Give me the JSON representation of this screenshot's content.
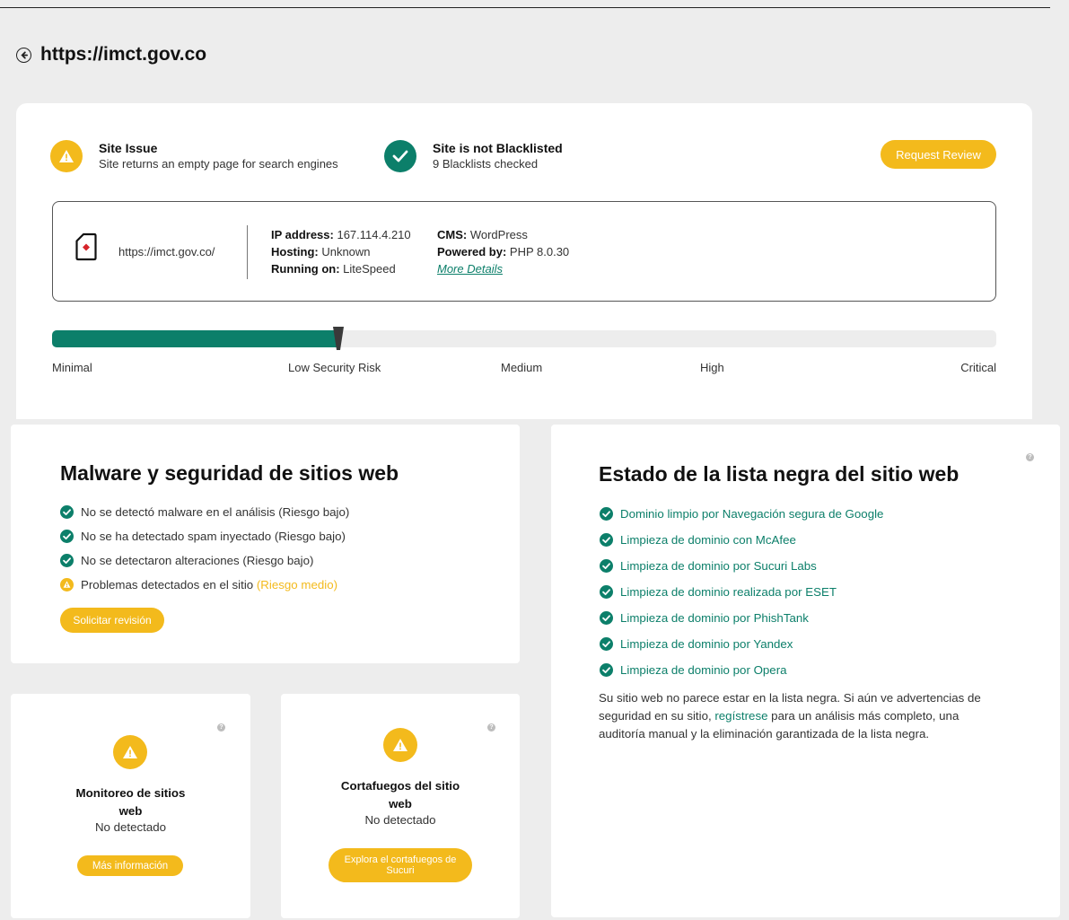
{
  "header": {
    "title": "https://imct.gov.co"
  },
  "summary": {
    "issue_title": "Site Issue",
    "issue_sub": "Site returns an empty page for search engines",
    "blacklist_title": "Site is not Blacklisted",
    "blacklist_sub": "9 Blacklists checked",
    "request_review": "Request Review"
  },
  "site_info": {
    "url": "https://imct.gov.co/",
    "ip_label": "IP address:",
    "ip_value": " 167.114.4.210",
    "hosting_label": "Hosting:",
    "hosting_value": " Unknown",
    "running_label": "Running on:",
    "running_value": " LiteSpeed",
    "cms_label": "CMS:",
    "cms_value": " WordPress",
    "powered_label": "Powered by:",
    "powered_value": " PHP 8.0.30",
    "more_details": "More Details"
  },
  "risk": {
    "level_fraction": 0.302,
    "labels": [
      "Minimal",
      "Low Security Risk",
      "Medium",
      "High",
      "Critical"
    ]
  },
  "malware": {
    "title": "Malware y seguridad de sitios web",
    "items": [
      {
        "text": "No se detectó malware en el análisis (Riesgo bajo)",
        "status": "ok"
      },
      {
        "text": "No se ha detectado spam inyectado (Riesgo bajo)",
        "status": "ok"
      },
      {
        "text": "No se detectaron alteraciones (Riesgo bajo)",
        "status": "ok"
      },
      {
        "text": "Problemas detectados en el sitio ",
        "status": "warn",
        "risk": "(Riesgo medio)"
      }
    ],
    "button": "Solicitar revisión"
  },
  "blacklist": {
    "title": "Estado de la lista negra del sitio web",
    "items": [
      "Dominio limpio por Navegación segura de Google",
      "Limpieza de dominio con McAfee",
      "Limpieza de dominio por Sucuri Labs",
      "Limpieza de dominio realizada por ESET",
      "Limpieza de dominio por PhishTank",
      "Limpieza de dominio por Yandex",
      "Limpieza de dominio por Opera"
    ],
    "text_before": "Su sitio web no parece estar en la lista negra. Si aún ve advertencias de seguridad en su sitio, ",
    "text_link": "regístrese",
    "text_after": " para un análisis más completo, una auditoría manual y la eliminación garantizada de la lista negra."
  },
  "monitoring": {
    "title": "Monitoreo de sitios web",
    "status": "No detectado",
    "button": "Más información"
  },
  "firewall": {
    "title": "Cortafuegos del sitio web",
    "status": "No detectado",
    "button": "Explora el cortafuegos de Sucuri"
  },
  "help_glyph": "?",
  "colors": {
    "accent_green": "#0c7f6a",
    "accent_yellow": "#f3ba1c",
    "background": "#ededed"
  }
}
